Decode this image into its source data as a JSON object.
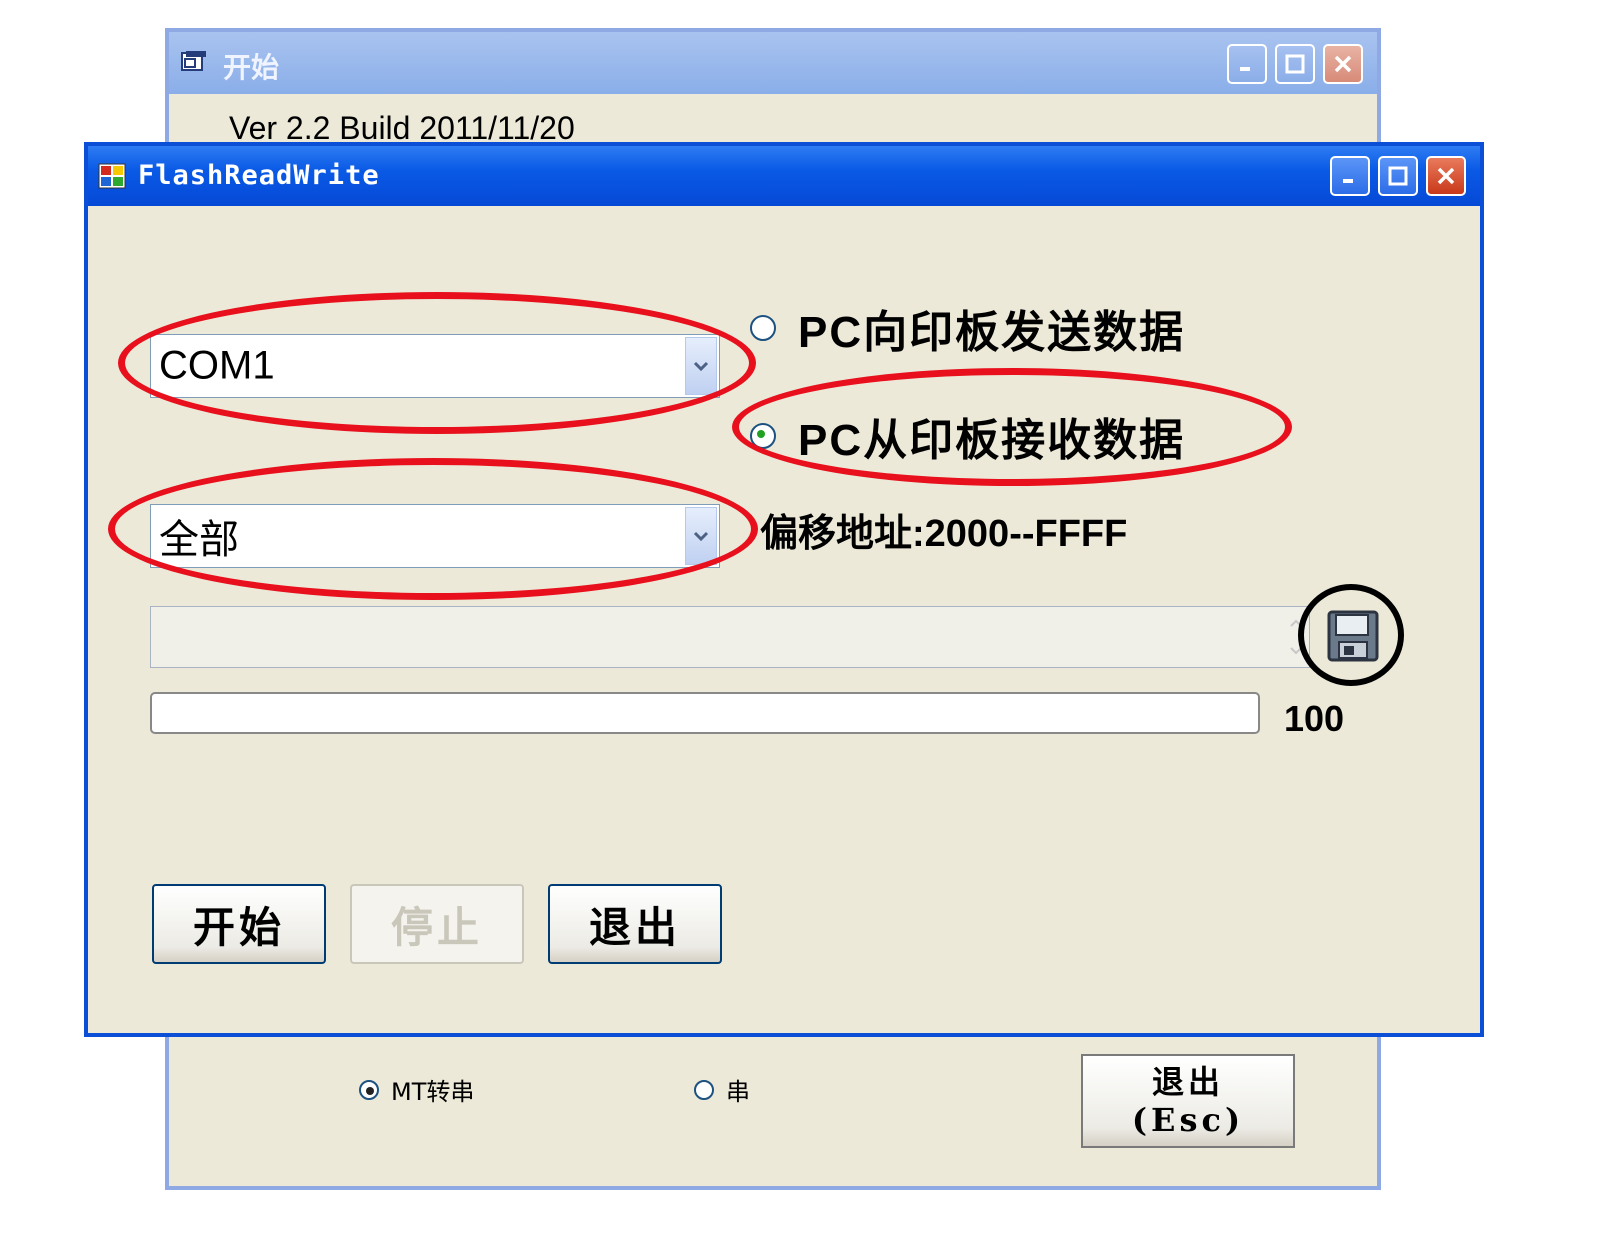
{
  "start_window": {
    "title": "开始",
    "version": "Ver 2.2 Build 2011/11/20",
    "radio_mt": "MT转串",
    "radio_serial": "串",
    "exit_button_line1": "退出",
    "exit_button_line2": "(Esc)"
  },
  "flash_window": {
    "title": "FlashReadWrite",
    "port_combo": {
      "value": "COM1"
    },
    "range_combo": {
      "value": "全部"
    },
    "radio_send": "PC向印板发送数据",
    "radio_receive": "PC从印板接收数据",
    "selected_radio": "receive",
    "offset_label": "偏移地址:2000--FFFF",
    "progress": {
      "value_text": "100",
      "fraction": 0.0
    },
    "buttons": {
      "start": "开始",
      "stop": "停止",
      "exit": "退出"
    },
    "stop_enabled": false
  },
  "annotations": {
    "highlight_color": "#e8101c",
    "save_ring_color": "#000000"
  }
}
